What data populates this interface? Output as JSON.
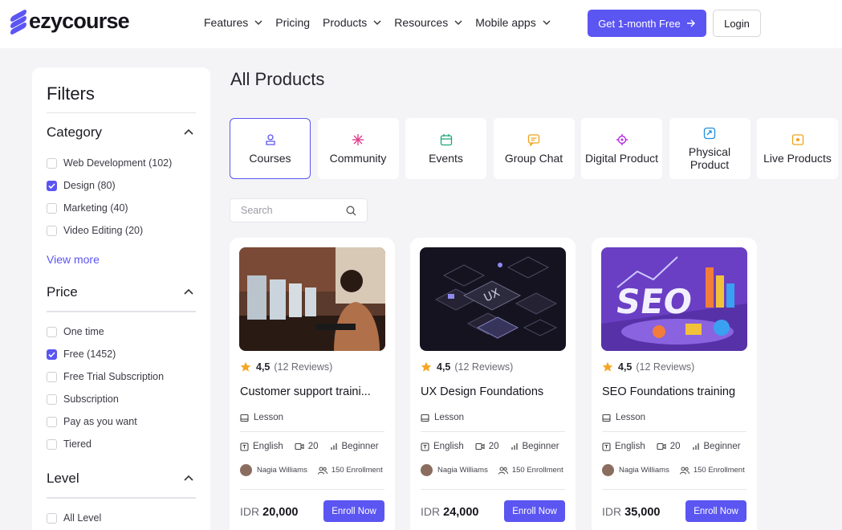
{
  "header": {
    "logo": "ezycourse",
    "nav": [
      {
        "label": "Features",
        "has_dropdown": true
      },
      {
        "label": "Pricing",
        "has_dropdown": false
      },
      {
        "label": "Products",
        "has_dropdown": true
      },
      {
        "label": "Resources",
        "has_dropdown": true
      },
      {
        "label": "Mobile apps",
        "has_dropdown": true
      }
    ],
    "cta_label": "Get 1-month Free",
    "login_label": "Login"
  },
  "filters": {
    "title": "Filters",
    "category": {
      "heading": "Category",
      "options": [
        {
          "label": "Web Development (102)",
          "checked": false
        },
        {
          "label": "Design (80)",
          "checked": true
        },
        {
          "label": "Marketing (40)",
          "checked": false
        },
        {
          "label": "Video Editing (20)",
          "checked": false
        }
      ],
      "view_more": "View more"
    },
    "price": {
      "heading": "Price",
      "options": [
        {
          "label": "One time",
          "checked": false
        },
        {
          "label": "Free (1452)",
          "checked": true
        },
        {
          "label": "Free Trial Subscription",
          "checked": false
        },
        {
          "label": "Subscription",
          "checked": false
        },
        {
          "label": "Pay as you want",
          "checked": false
        },
        {
          "label": "Tiered",
          "checked": false
        }
      ]
    },
    "level": {
      "heading": "Level",
      "options": [
        {
          "label": "All Level",
          "checked": false
        }
      ]
    }
  },
  "main": {
    "title": "All Products",
    "types": [
      {
        "label": "Courses",
        "icon": "course-icon",
        "active": true
      },
      {
        "label": "Community",
        "icon": "community-icon",
        "active": false
      },
      {
        "label": "Events",
        "icon": "calendar-icon",
        "active": false
      },
      {
        "label": "Group Chat",
        "icon": "chat-icon",
        "active": false
      },
      {
        "label": "Digital Product",
        "icon": "digital-product-icon",
        "active": false
      },
      {
        "label": "Physical Product",
        "icon": "physical-product-icon",
        "active": false
      },
      {
        "label": "Live Products",
        "icon": "live-product-icon",
        "active": false
      }
    ],
    "search_placeholder": "Search"
  },
  "cards": [
    {
      "rating": "4,5",
      "reviews": "(12 Reviews)",
      "title": "Customer support traini...",
      "type": "Lesson",
      "language": "English",
      "videos": "20",
      "level": "Beginner",
      "author": "Nagia Williams",
      "enrollment": "150 Enrollment",
      "currency": "IDR",
      "price": "20,000",
      "enroll_label": "Enroll Now"
    },
    {
      "rating": "4,5",
      "reviews": "(12 Reviews)",
      "title": "UX Design Foundations",
      "type": "Lesson",
      "language": "English",
      "videos": "20",
      "level": "Beginner",
      "author": "Nagia Williams",
      "enrollment": "150 Enrollment",
      "currency": "IDR",
      "price": "24,000",
      "enroll_label": "Enroll Now"
    },
    {
      "rating": "4,5",
      "reviews": "(12 Reviews)",
      "title": "SEO Foundations training",
      "type": "Lesson",
      "language": "English",
      "videos": "20",
      "level": "Beginner",
      "author": "Nagia Williams",
      "enrollment": "150 Enrollment",
      "currency": "IDR",
      "price": "35,000",
      "enroll_label": "Enroll Now"
    }
  ],
  "colors": {
    "accent": "#5b55f2",
    "star": "#f5a623",
    "background": "#f4f4f6"
  }
}
